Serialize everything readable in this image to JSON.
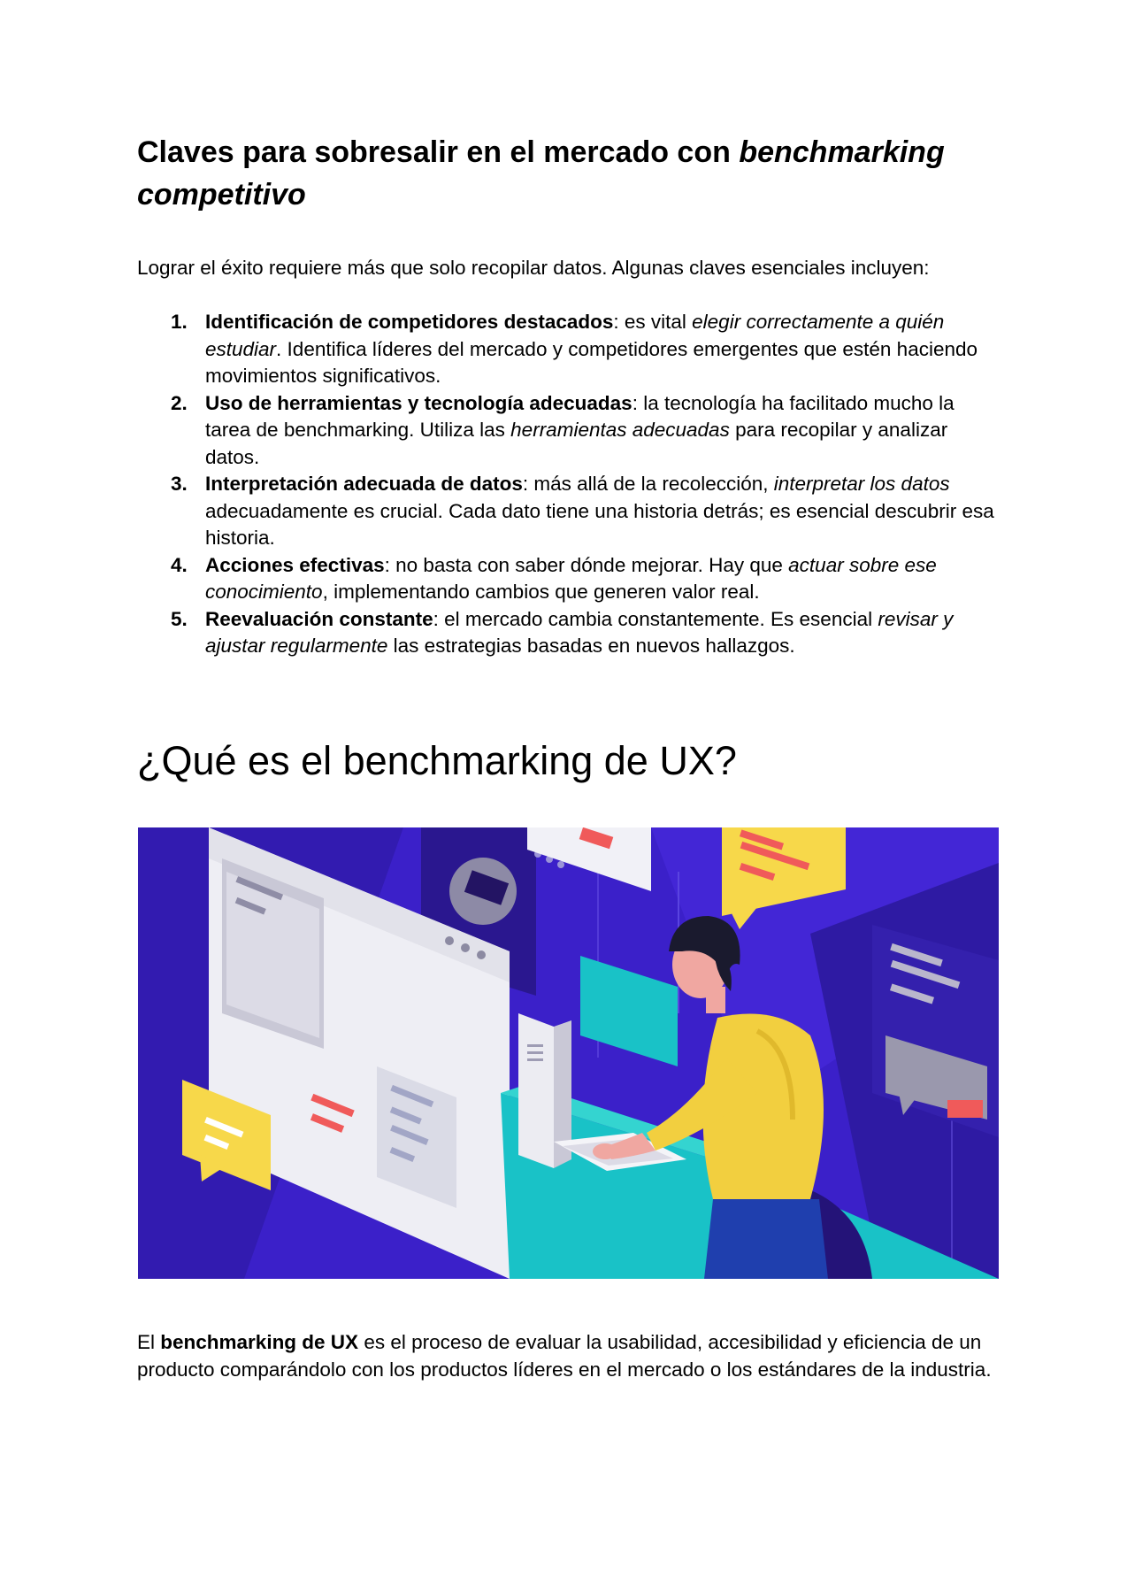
{
  "section": {
    "heading_plain": "Claves para sobresalir en el mercado con ",
    "heading_italic": "benchmarking competitivo",
    "intro": "Lograr el éxito requiere más que solo recopilar datos. Algunas claves esenciales incluyen:",
    "keys": [
      {
        "number": "1.",
        "term": "Identificación de competidores destacados",
        "text_a": ": es vital ",
        "italic": "elegir correctamente a quién estudiar",
        "text_b": ". Identifica líderes del mercado y competidores emergentes que estén haciendo movimientos significativos."
      },
      {
        "number": "2.",
        "term": "Uso de herramientas y tecnología adecuadas",
        "text_a": ": la tecnología ha facilitado mucho la tarea de benchmarking. Utiliza las ",
        "italic": "herramientas adecuadas",
        "text_b": " para recopilar y analizar datos."
      },
      {
        "number": "3.",
        "term": "Interpretación adecuada de datos",
        "text_a": ": más allá de la recolección, ",
        "italic": "interpretar los datos",
        "text_b": " adecuadamente es crucial. Cada dato tiene una historia detrás; es esencial descubrir esa historia."
      },
      {
        "number": "4.",
        "term": "Acciones efectivas",
        "text_a": ": no basta con saber dónde mejorar. Hay que ",
        "italic": "actuar sobre ese conocimiento",
        "text_b": ", implementando cambios que generen valor real."
      },
      {
        "number": "5.",
        "term": "Reevaluación constante",
        "text_a": ": el mercado cambia constantemente. Es esencial ",
        "italic": "revisar y ajustar regularmente",
        "text_b": " las estrategias basadas en nuevos hallazgos."
      }
    ]
  },
  "ux_section": {
    "heading": "¿Qué es el benchmarking de UX?",
    "paragraph_prefix": "El ",
    "paragraph_term": "benchmarking de UX",
    "paragraph_rest": " es el proceso de evaluar la usabilidad, accesibilidad y eficiencia de un producto comparándolo con los productos líderes en el mercado o los estándares de la industria."
  },
  "illustration": {
    "icon": "designer-at-computer-illustration",
    "colors": {
      "background": "#3b20c9",
      "accent_yellow": "#f7d84a",
      "accent_red": "#f05a5a",
      "accent_teal": "#19c2c7",
      "shirt": "#f2cf3f"
    }
  }
}
